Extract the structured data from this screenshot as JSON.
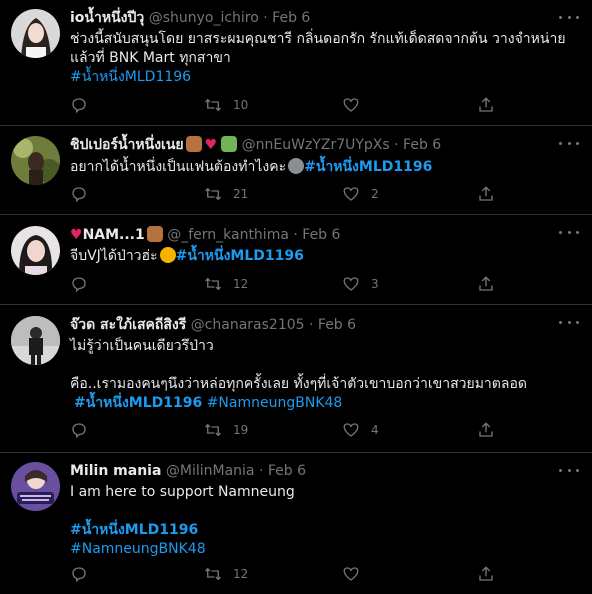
{
  "tweets": [
    {
      "name": "ioน้ำหนึ่งปีวุ",
      "handle": "@shunyo_ichiro",
      "date": "· Feb 6",
      "line1": "ช่วงนี้สนับสนุนโดย ยาสระผมคุณชารี กลิ่นดอกรัก รักแท้เด็ดสดจากต้น วางจำหน่าย",
      "line2": "แล้วที่ BNK Mart ทุกสาขา",
      "tag1": "#น้ำหนึ่งMLD1196",
      "retweets": "10",
      "likes": ""
    },
    {
      "name": "ชิปเปอร์น้ำหนึ่งเนย",
      "handle": "@nnEuWzYZr7UYpXs",
      "date": "· Feb 6",
      "line1": "อยากได้น้ำหนึ่งเป็นแฟนต้องทำไงคะ",
      "tag1": "#น้ำหนึ่งMLD1196",
      "retweets": "21",
      "likes": "2"
    },
    {
      "name": "NAM...1",
      "handle": "@_fern_kanthima",
      "date": "· Feb 6",
      "line1": "จีบVJได้ป่าวฮ่ะ",
      "tag1": "#น้ำหนึ่งMLD1196",
      "retweets": "12",
      "likes": "3"
    },
    {
      "name": "จ๊วด สะใภ้เสคถีสิงรี",
      "handle": "@chanaras2105",
      "date": "· Feb 6",
      "line1": "ไม่รู้ว่าเป็นคนเดียวรึป่าว",
      "line2": "คือ..เรามองคนๆนึงว่าหล่อทุกครั้งเลย ทั้งๆที่เจ้าตัวเขาบอกว่าเขาสวยมาตลอด",
      "tag1": "#น้ำหนึ่งMLD1196",
      "tag2": "#NamneungBNK48",
      "retweets": "19",
      "likes": "4"
    },
    {
      "name": "Milin mania",
      "handle": "@MilinMania",
      "date": "· Feb 6",
      "line1": "I am here to support Namneung",
      "tag1": "#น้ำหนึ่งMLD1196",
      "tag2": "#NamneungBNK48",
      "retweets": "12",
      "likes": ""
    }
  ]
}
